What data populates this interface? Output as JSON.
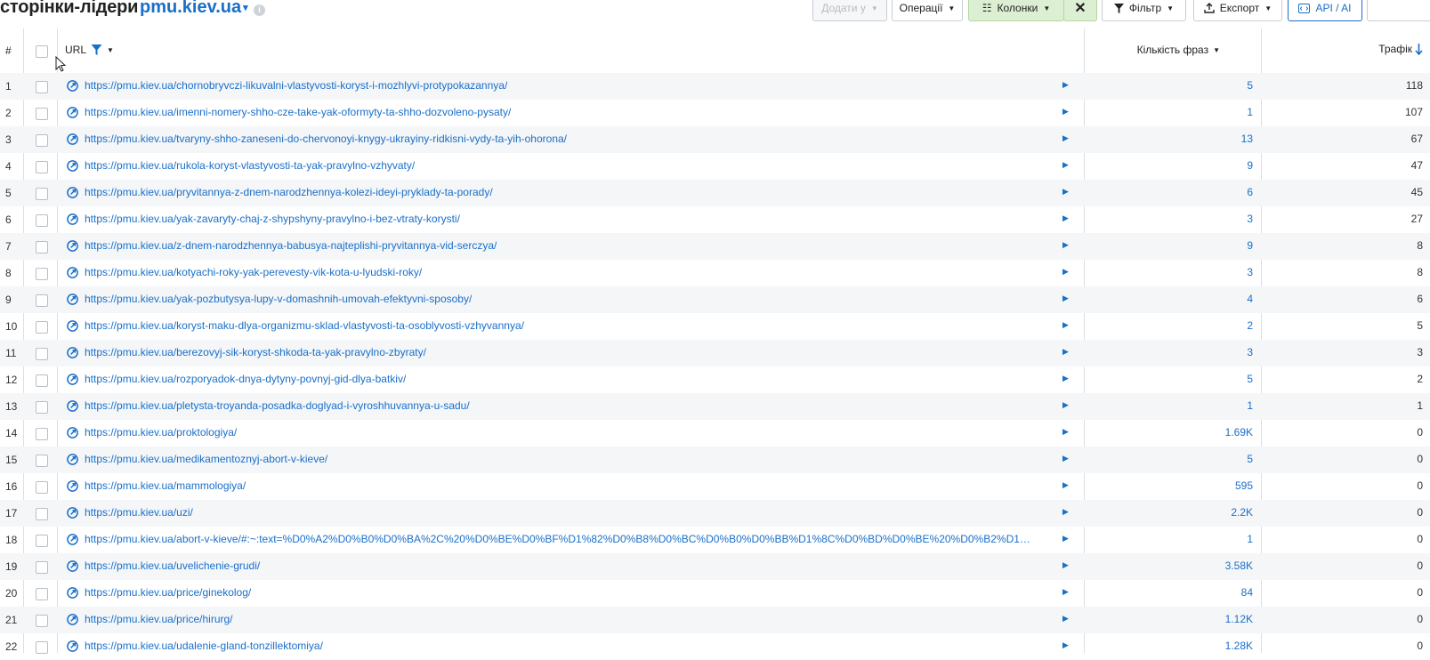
{
  "header": {
    "title": "сторінки-лідери",
    "domain": "pmu.kiev.ua",
    "info_glyph": "i",
    "buttons": {
      "add_to": "Додати у",
      "operations": "Операції",
      "columns": "Колонки",
      "filter": "Фільтр",
      "export": "Експорт",
      "api": "API / AI"
    }
  },
  "table": {
    "columns": {
      "num": "#",
      "url": "URL",
      "phrases": "Кількість фраз",
      "traffic": "Трафік"
    },
    "rows": [
      {
        "n": "1",
        "url": "https://pmu.kiev.ua/chornobryvczi-likuvalni-vlastyvosti-koryst-i-mozhlyvi-protypokazannya/",
        "phrases": "5",
        "traffic": "118"
      },
      {
        "n": "2",
        "url": "https://pmu.kiev.ua/imenni-nomery-shho-cze-take-yak-oformyty-ta-shho-dozvoleno-pysaty/",
        "phrases": "1",
        "traffic": "107"
      },
      {
        "n": "3",
        "url": "https://pmu.kiev.ua/tvaryny-shho-zaneseni-do-chervonoyi-knygy-ukrayiny-ridkisni-vydy-ta-yih-ohorona/",
        "phrases": "13",
        "traffic": "67"
      },
      {
        "n": "4",
        "url": "https://pmu.kiev.ua/rukola-koryst-vlastyvosti-ta-yak-pravylno-vzhyvaty/",
        "phrases": "9",
        "traffic": "47"
      },
      {
        "n": "5",
        "url": "https://pmu.kiev.ua/pryvitannya-z-dnem-narodzhennya-kolezi-ideyi-pryklady-ta-porady/",
        "phrases": "6",
        "traffic": "45"
      },
      {
        "n": "6",
        "url": "https://pmu.kiev.ua/yak-zavaryty-chaj-z-shypshyny-pravylno-i-bez-vtraty-korysti/",
        "phrases": "3",
        "traffic": "27"
      },
      {
        "n": "7",
        "url": "https://pmu.kiev.ua/z-dnem-narodzhennya-babusya-najteplishi-pryvitannya-vid-serczya/",
        "phrases": "9",
        "traffic": "8"
      },
      {
        "n": "8",
        "url": "https://pmu.kiev.ua/kotyachi-roky-yak-perevesty-vik-kota-u-lyudski-roky/",
        "phrases": "3",
        "traffic": "8"
      },
      {
        "n": "9",
        "url": "https://pmu.kiev.ua/yak-pozbutysya-lupy-v-domashnih-umovah-efektyvni-sposoby/",
        "phrases": "4",
        "traffic": "6"
      },
      {
        "n": "10",
        "url": "https://pmu.kiev.ua/koryst-maku-dlya-organizmu-sklad-vlastyvosti-ta-osoblyvosti-vzhyvannya/",
        "phrases": "2",
        "traffic": "5"
      },
      {
        "n": "11",
        "url": "https://pmu.kiev.ua/berezovyj-sik-koryst-shkoda-ta-yak-pravylno-zbyraty/",
        "phrases": "3",
        "traffic": "3"
      },
      {
        "n": "12",
        "url": "https://pmu.kiev.ua/rozporyadok-dnya-dytyny-povnyj-gid-dlya-batkiv/",
        "phrases": "5",
        "traffic": "2"
      },
      {
        "n": "13",
        "url": "https://pmu.kiev.ua/pletysta-troyanda-posadka-doglyad-i-vyroshhuvannya-u-sadu/",
        "phrases": "1",
        "traffic": "1"
      },
      {
        "n": "14",
        "url": "https://pmu.kiev.ua/proktologiya/",
        "phrases": "1.69K",
        "traffic": "0"
      },
      {
        "n": "15",
        "url": "https://pmu.kiev.ua/medikamentoznyj-abort-v-kieve/",
        "phrases": "5",
        "traffic": "0"
      },
      {
        "n": "16",
        "url": "https://pmu.kiev.ua/mammologiya/",
        "phrases": "595",
        "traffic": "0"
      },
      {
        "n": "17",
        "url": "https://pmu.kiev.ua/uzi/",
        "phrases": "2.2K",
        "traffic": "0"
      },
      {
        "n": "18",
        "url": "https://pmu.kiev.ua/abort-v-kieve/#:~:text=%D0%A2%D0%B0%D0%BA%2C%20%D0%BE%D0%BF%D1%82%D0%B8%D0%BC%D0%B0%D0%BB%D1%8C%D0%BD%D0%BE%20%D0%B2%D1%80%D0...",
        "phrases": "1",
        "traffic": "0"
      },
      {
        "n": "19",
        "url": "https://pmu.kiev.ua/uvelichenie-grudi/",
        "phrases": "3.58K",
        "traffic": "0"
      },
      {
        "n": "20",
        "url": "https://pmu.kiev.ua/price/ginekolog/",
        "phrases": "84",
        "traffic": "0"
      },
      {
        "n": "21",
        "url": "https://pmu.kiev.ua/price/hirurg/",
        "phrases": "1.12K",
        "traffic": "0"
      },
      {
        "n": "22",
        "url": "https://pmu.kiev.ua/udalenie-gland-tonzillektomiya/",
        "phrases": "1.28K",
        "traffic": "0"
      }
    ]
  }
}
